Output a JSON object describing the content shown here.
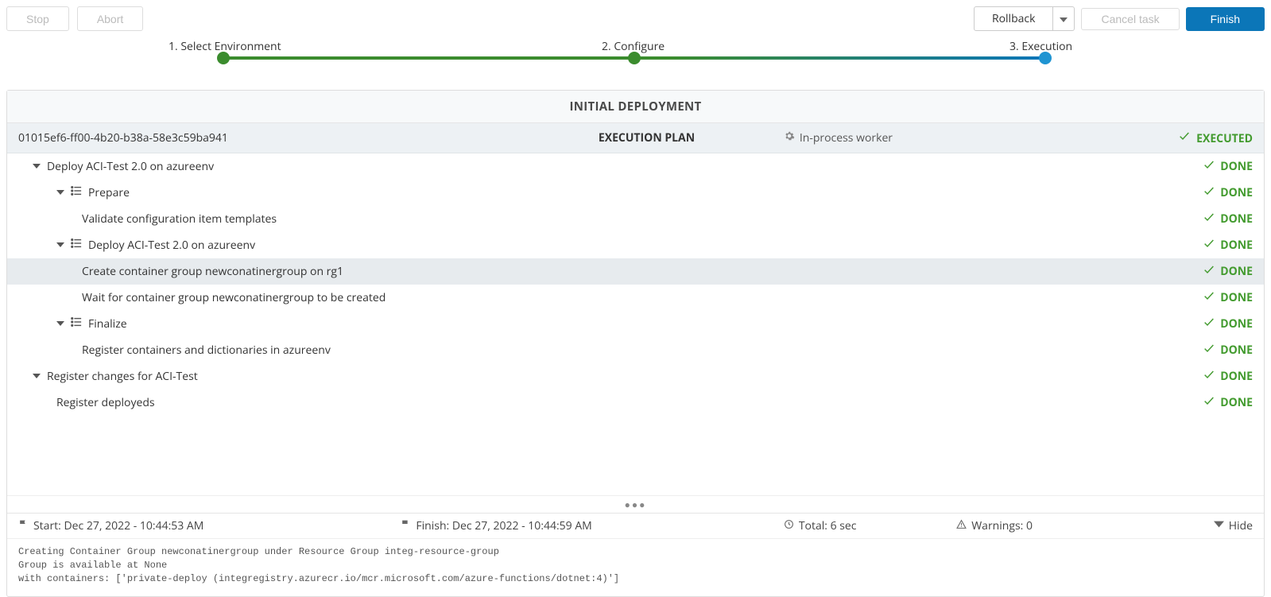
{
  "toolbar": {
    "stop": "Stop",
    "abort": "Abort",
    "rollback": "Rollback",
    "cancel": "Cancel task",
    "finish": "Finish"
  },
  "wizard": {
    "step1": "1. Select Environment",
    "step2": "2. Configure",
    "step3": "3. Execution"
  },
  "section_title": "INITIAL DEPLOYMENT",
  "plan": {
    "uuid": "01015ef6-ff00-4b20-b38a-58e3c59ba941",
    "title": "EXECUTION PLAN",
    "worker": "In-process worker",
    "status": "EXECUTED"
  },
  "rows": [
    {
      "indent": 1,
      "caret": true,
      "listicon": false,
      "label": "Deploy ACI-Test 2.0 on azureenv",
      "status": "DONE",
      "selected": false
    },
    {
      "indent": 2,
      "caret": true,
      "listicon": true,
      "label": "Prepare",
      "status": "DONE",
      "selected": false
    },
    {
      "indent": 3,
      "caret": false,
      "listicon": false,
      "label": "Validate configuration item templates",
      "status": "DONE",
      "selected": false
    },
    {
      "indent": 2,
      "caret": true,
      "listicon": true,
      "label": "Deploy ACI-Test 2.0 on azureenv",
      "status": "DONE",
      "selected": false
    },
    {
      "indent": 3,
      "caret": false,
      "listicon": false,
      "label": "Create container group newconatinergroup on rg1",
      "status": "DONE",
      "selected": true
    },
    {
      "indent": 3,
      "caret": false,
      "listicon": false,
      "label": "Wait for container group newconatinergroup to be created",
      "status": "DONE",
      "selected": false
    },
    {
      "indent": 2,
      "caret": true,
      "listicon": true,
      "label": "Finalize",
      "status": "DONE",
      "selected": false
    },
    {
      "indent": 3,
      "caret": false,
      "listicon": false,
      "label": "Register containers and dictionaries in azureenv",
      "status": "DONE",
      "selected": false
    },
    {
      "indent": 1,
      "caret": true,
      "listicon": false,
      "label": "Register changes for ACI-Test",
      "status": "DONE",
      "selected": false
    },
    {
      "indent": 2,
      "caret": false,
      "listicon": false,
      "label": "Register deployeds",
      "status": "DONE",
      "selected": false
    }
  ],
  "meta": {
    "start": "Start: Dec 27, 2022 - 10:44:53 AM",
    "finish": "Finish: Dec 27, 2022 - 10:44:59 AM",
    "total": "Total: 6 sec",
    "warnings": "Warnings: 0",
    "hide": "Hide"
  },
  "log": "Creating Container Group newconatinergroup under Resource Group integ-resource-group\nGroup is available at None\nwith containers: ['private-deploy (integregistry.azurecr.io/mcr.microsoft.com/azure-functions/dotnet:4)']"
}
